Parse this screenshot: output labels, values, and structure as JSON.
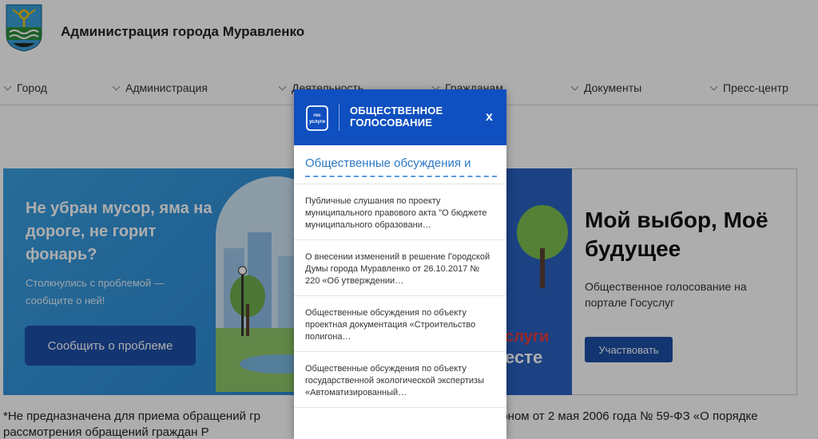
{
  "header": {
    "site_title": "Администрация города Муравленко"
  },
  "nav": {
    "items": [
      {
        "label": "Город"
      },
      {
        "label": "Администрация"
      },
      {
        "label": "Деятельность"
      },
      {
        "label": "Гражданам"
      },
      {
        "label": "Документы"
      },
      {
        "label": "Пресс-центр"
      }
    ]
  },
  "banner_left": {
    "headline": "Не убран мусор, яма на дороге, не горит фонарь?",
    "subtext": "Столкнулись с проблемой — сообщите о ней!",
    "button_label": "Сообщить о проблеме",
    "gos_text_1": "слуги",
    "gos_text_2": "есте"
  },
  "banner_right": {
    "title": "Мой выбор, Моё будущее",
    "subtext": "Общественное голосование на портале Госуслуг",
    "button_label": "Участвовать"
  },
  "note": {
    "text": "*Не предназначена для приема обращений гр                                                           ным законом от 2 мая 2006 года № 59-ФЗ «О порядке рассмотрения обращений граждан Р"
  },
  "popup": {
    "logo_text_1": "гос",
    "logo_text_2": "услуги",
    "title_line_1": "ОБЩЕСТВЕННОЕ",
    "title_line_2": "ГОЛОСОВАНИЕ",
    "close_label": "x",
    "tab_label": "Общественные обсуждения и",
    "items": [
      {
        "text": "Публичные слушания по проекту муниципального правового акта \"О бюджете муниципального образовани…"
      },
      {
        "text": "О внесении изменений в решение Городской Думы города Муравленко от 26.10.2017 № 220 «Об утверждении…"
      },
      {
        "text": "Общественные обсуждения по объекту проектная документация «Строительство полигона…"
      },
      {
        "text": "Общественные обсуждения по объекту государственной экологической экспертизы «Автоматизированный…"
      }
    ]
  },
  "colors": {
    "popup_header": "#0f4fc0",
    "primary_button": "#1d4fa8",
    "link": "#2a78c8"
  }
}
